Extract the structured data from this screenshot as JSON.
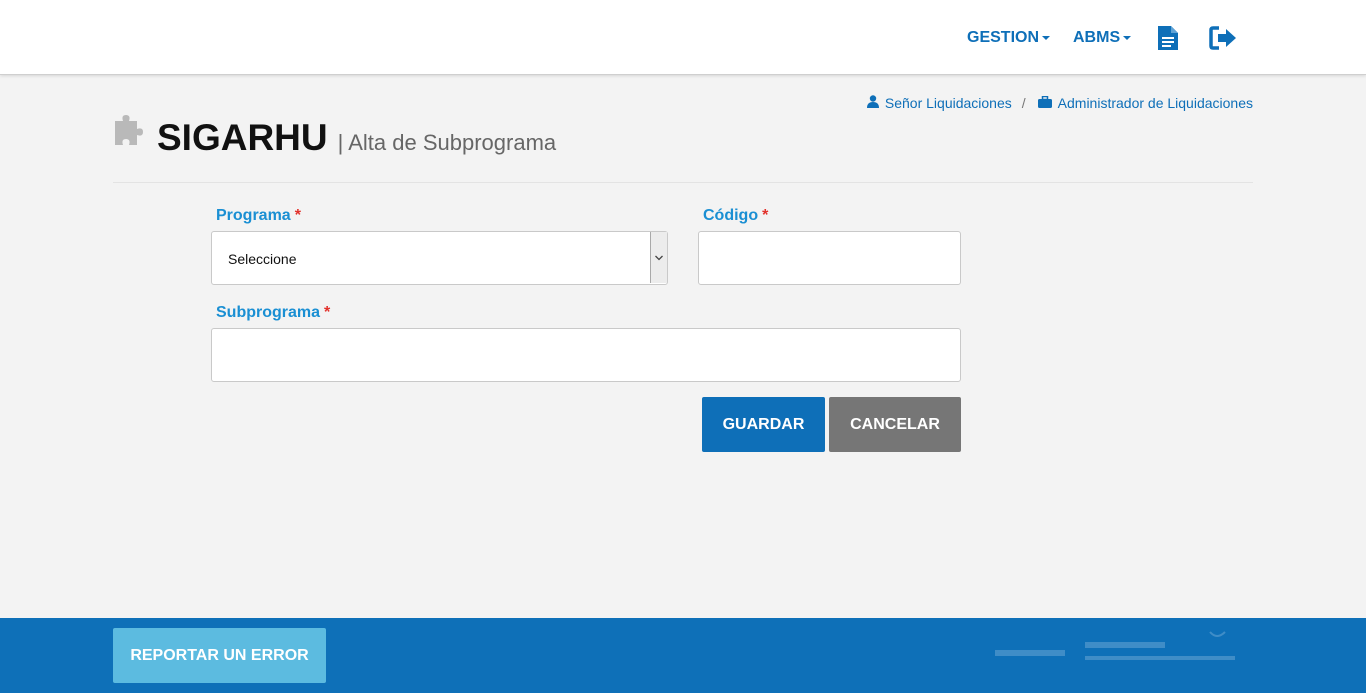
{
  "nav": {
    "gestion_label": "GESTION",
    "abms_label": "ABMS",
    "docs_icon": "document-icon",
    "logout_icon": "sign-out-icon"
  },
  "breadcrumb": {
    "user_label": "Señor Liquidaciones",
    "separator": "/",
    "role_label": "Administrador de Liquidaciones"
  },
  "header": {
    "app_title": "SIGARHU",
    "page_subtitle": "| Alta de Subprograma",
    "icon": "puzzle-icon"
  },
  "form": {
    "programa_label": "Programa",
    "programa_value": "Seleccione",
    "codigo_label": "Código",
    "codigo_value": "",
    "subprograma_label": "Subprograma",
    "subprograma_value": "",
    "required_mark": "*"
  },
  "actions": {
    "save_label": "GUARDAR",
    "cancel_label": "CANCELAR"
  },
  "footer": {
    "report_label": "REPORTAR UN ERROR"
  },
  "colors": {
    "primary": "#0e6fb8",
    "label_blue": "#1a8fd3",
    "required_red": "#e2312b",
    "cancel_gray": "#767676",
    "report_light_blue": "#5cbbe0"
  }
}
